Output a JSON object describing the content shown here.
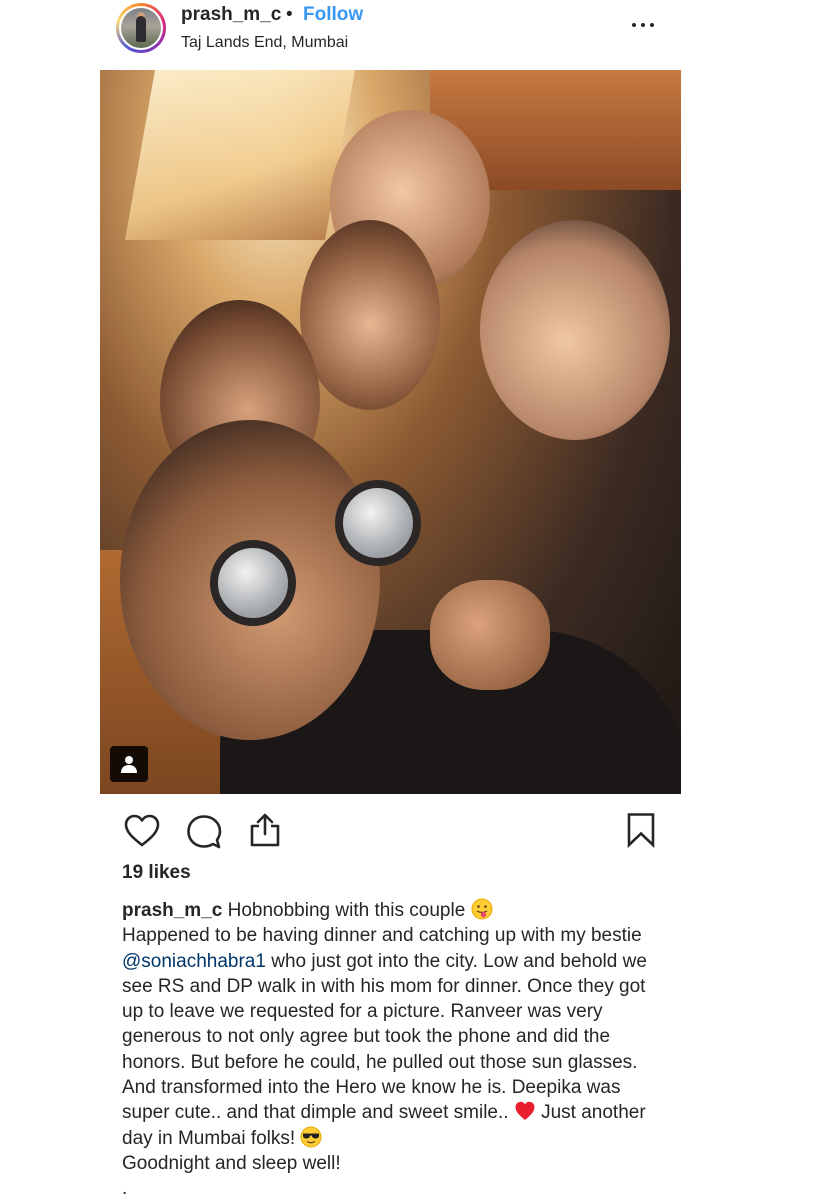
{
  "post": {
    "username": "prash_m_c",
    "separator": "•",
    "follow_label": "Follow",
    "location": "Taj Lands End, Mumbai",
    "more_icon": "more-horizontal-icon"
  },
  "actions": {
    "like_icon": "heart-icon",
    "comment_icon": "comment-icon",
    "share_icon": "share-icon",
    "save_icon": "bookmark-icon",
    "likes_text": "19 likes"
  },
  "caption": {
    "username": "prash_m_c",
    "line1": "Hobnobbing with this couple",
    "text_a": "Happened to be having dinner and catching up with my bestie",
    "mention": "@soniachhabra1",
    "text_b": "who just got into the city. Low and behold we see RS and DP walk in with his mom for dinner. Once they got up to leave we requested for a picture. Ranveer was very generous to not only agree but took the phone and did the honors. But before he could, he pulled out those sun glasses. And transformed into the Hero we know he is. Deepika was super cute.. and that dimple and sweet smile..",
    "text_c": "Just another day in Mumbai folks!",
    "text_d": "Goodnight and sleep well!",
    "trailing": "."
  },
  "colors": {
    "link": "#3897f0",
    "mention": "#003569",
    "text": "#262626"
  }
}
